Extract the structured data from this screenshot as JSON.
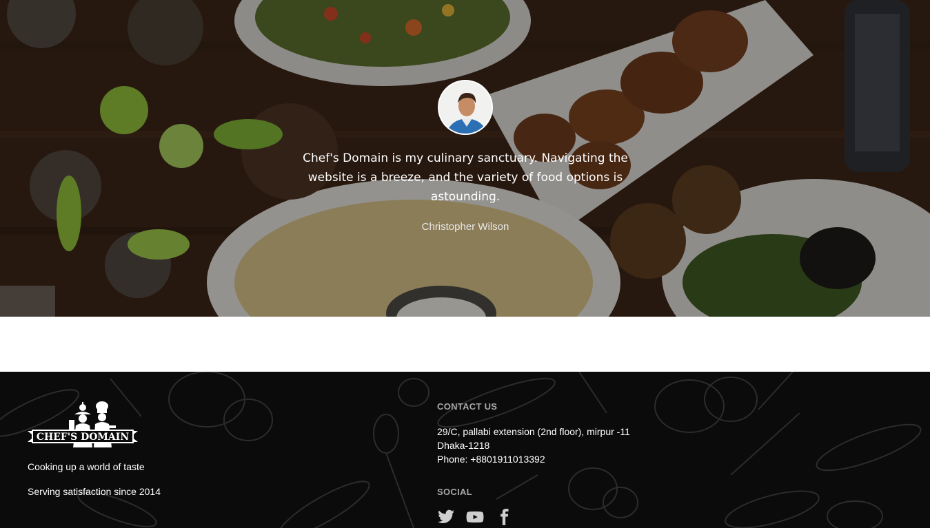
{
  "testimonial": {
    "quote": "Chef's Domain is my culinary sanctuary. Navigating the website is a breeze, and the variety of food options is astounding.",
    "author": "Christopher Wilson"
  },
  "footer": {
    "logo_text": "CHEF'S DOMAIN",
    "tagline_1": "Cooking up a world of taste",
    "tagline_2": "Serving satisfaction since 2014",
    "contact": {
      "title": "CONTACT US",
      "address_line_1": "29/C, pallabi extension (2nd floor), mirpur -11",
      "address_line_2": "Dhaka-1218",
      "phone": "Phone: +8801911013392"
    },
    "social": {
      "title": "SOCIAL",
      "icons": [
        "twitter-icon",
        "youtube-icon",
        "facebook-icon"
      ]
    }
  },
  "colors": {
    "footer_bg": "#0b0b0b",
    "section_title": "#a8a8a8",
    "hero_wood": "#3a2416"
  }
}
